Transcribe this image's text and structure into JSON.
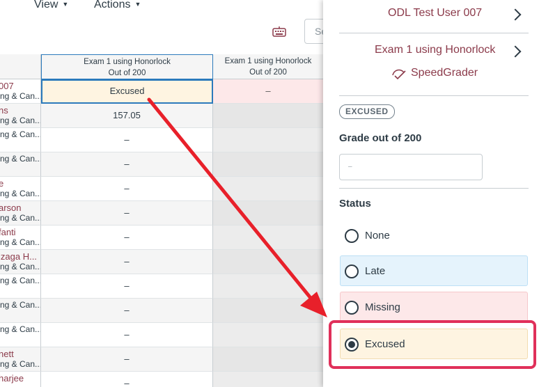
{
  "toolbar": {
    "view_label": "View",
    "actions_label": "Actions",
    "search_placeholder": "Se"
  },
  "columns": [
    {
      "title": "Exam 1 using Honorlock",
      "subtitle": "Out of 200"
    },
    {
      "title": "Exam 1 using Honorlock",
      "subtitle": "Out of 200"
    }
  ],
  "rows": [
    {
      "name": "007",
      "section": "ng & Can...",
      "grade": "Excused",
      "grade2": "–"
    },
    {
      "name": "ns",
      "section": "ng & Can...",
      "grade": "157.05",
      "grade2": ""
    },
    {
      "name": "",
      "section": "ng & Can...",
      "grade": "–",
      "grade2": ""
    },
    {
      "name": "",
      "section": "ng & Can...",
      "grade": "–",
      "grade2": ""
    },
    {
      "name": "e",
      "section": "ng & Can...",
      "grade": "–",
      "grade2": ""
    },
    {
      "name": "arson",
      "section": "ng & Can...",
      "grade": "–",
      "grade2": ""
    },
    {
      "name": "fanti",
      "section": "ng & Can...",
      "grade": "–",
      "grade2": ""
    },
    {
      "name": "izaga H...",
      "section": "ng & Can...",
      "grade": "–",
      "grade2": ""
    },
    {
      "name": "",
      "section": "ng & Can...",
      "grade": "–",
      "grade2": ""
    },
    {
      "name": "",
      "section": "ng & Can...",
      "grade": "–",
      "grade2": ""
    },
    {
      "name": "",
      "section": "ng & Can...",
      "grade": "–",
      "grade2": ""
    },
    {
      "name": "nett",
      "section": "ng & Can...",
      "grade": "–",
      "grade2": ""
    },
    {
      "name": "harjee",
      "section": "",
      "grade": "–",
      "grade2": ""
    }
  ],
  "tray": {
    "student_name": "ODL Test User 007",
    "assignment_name": "Exam 1 using Honorlock",
    "speedgrader_label": "SpeedGrader",
    "status_badge": "EXCUSED",
    "grade_label": "Grade out of 200",
    "grade_placeholder": "–",
    "status_label": "Status",
    "options": [
      {
        "label": "None",
        "bg": "#ffffff",
        "border": "#ffffff",
        "selected": false
      },
      {
        "label": "Late",
        "bg": "#e5f3fc",
        "border": "#bcdff5",
        "selected": false
      },
      {
        "label": "Missing",
        "bg": "#fde8e9",
        "border": "#f6c7ca",
        "selected": false
      },
      {
        "label": "Excused",
        "bg": "#fef4e1",
        "border": "#f2dcb0",
        "selected": true
      }
    ]
  },
  "colors": {
    "link": "#8b3a4a",
    "annotation_red": "#e8202a",
    "highlight_border": "#e0305a",
    "selected_cell_bg": "#fef4e1",
    "selected_cell_border": "#2b7abc",
    "row_missing_bg": "#fde8e9"
  }
}
